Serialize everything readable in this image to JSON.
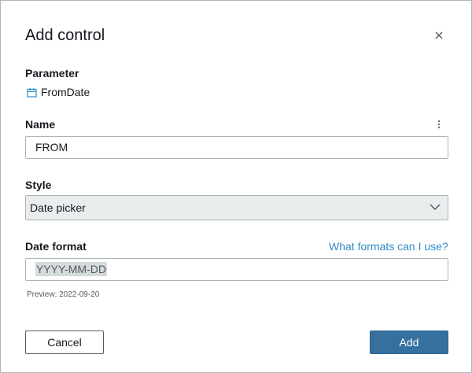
{
  "dialog": {
    "title": "Add control",
    "close_icon": "close-icon"
  },
  "parameter": {
    "label": "Parameter",
    "icon": "calendar-icon",
    "value": "FromDate"
  },
  "name": {
    "label": "Name",
    "menu_icon": "kebab-menu-icon",
    "value": "FROM"
  },
  "style": {
    "label": "Style",
    "selected": "Date picker",
    "dropdown_icon": "chevron-down-icon"
  },
  "date_format": {
    "label": "Date format",
    "help_link": "What formats can I use?",
    "value": "YYYY-MM-DD",
    "preview": "Preview: 2022-09-20"
  },
  "actions": {
    "cancel_label": "Cancel",
    "add_label": "Add"
  },
  "colors": {
    "primary_button": "#35709f",
    "link": "#2e8bc6",
    "border": "#aab7b8"
  }
}
